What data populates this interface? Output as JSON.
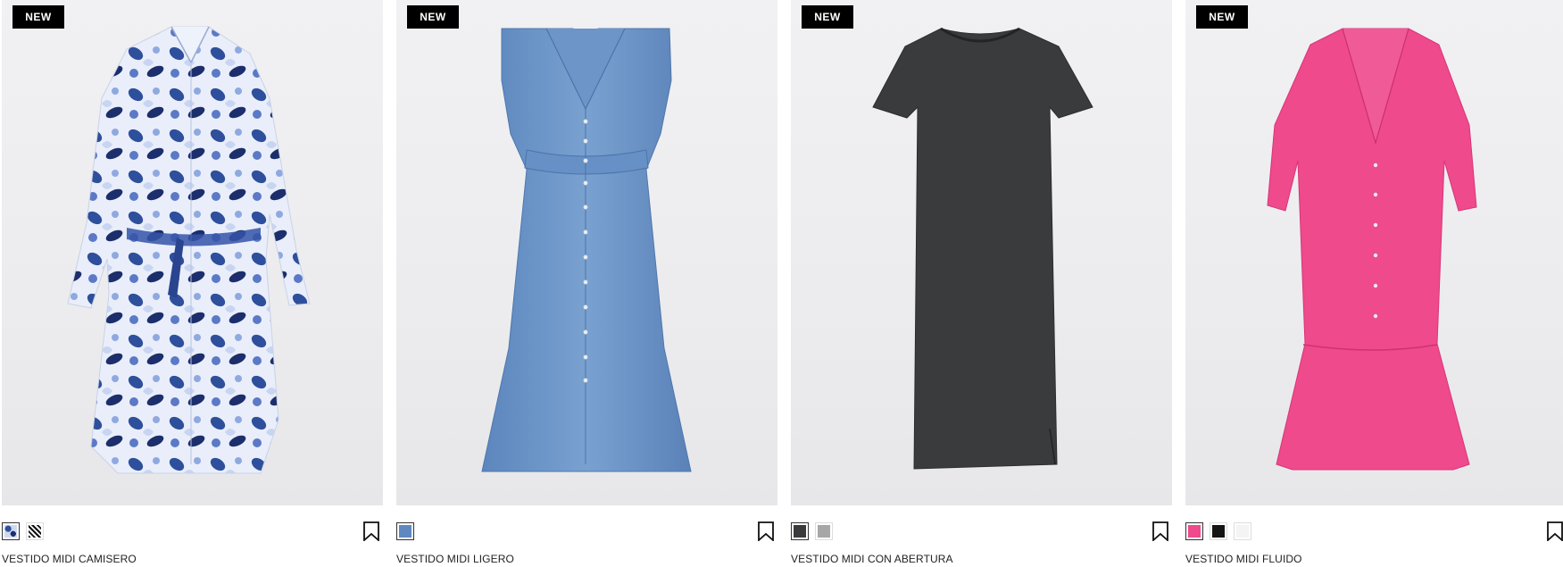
{
  "badge_text": "NEW",
  "products": [
    {
      "name": "VESTIDO MIDI CAMISERO",
      "badge": "NEW",
      "swatches": [
        {
          "color": "#6f8fd0",
          "pattern": "paisley-blue",
          "selected": true
        },
        {
          "color": "#222222",
          "pattern": "stripes-black",
          "selected": false
        }
      ]
    },
    {
      "name": "VESTIDO MIDI LIGERO",
      "badge": "NEW",
      "swatches": [
        {
          "color": "#5f88c0",
          "pattern": "solid",
          "selected": true
        }
      ]
    },
    {
      "name": "VESTIDO MIDI CON ABERTURA",
      "badge": "NEW",
      "swatches": [
        {
          "color": "#3a3b3d",
          "pattern": "solid",
          "selected": true
        },
        {
          "color": "#a7a7a7",
          "pattern": "solid",
          "selected": false
        }
      ]
    },
    {
      "name": "VESTIDO MIDI FLUIDO",
      "badge": "NEW",
      "swatches": [
        {
          "color": "#ee4a8c",
          "pattern": "solid",
          "selected": true
        },
        {
          "color": "#151515",
          "pattern": "solid",
          "selected": false
        },
        {
          "color": "#f4f4f4",
          "pattern": "solid",
          "selected": false
        }
      ]
    }
  ],
  "icons": {
    "bookmark": "bookmark-icon"
  }
}
